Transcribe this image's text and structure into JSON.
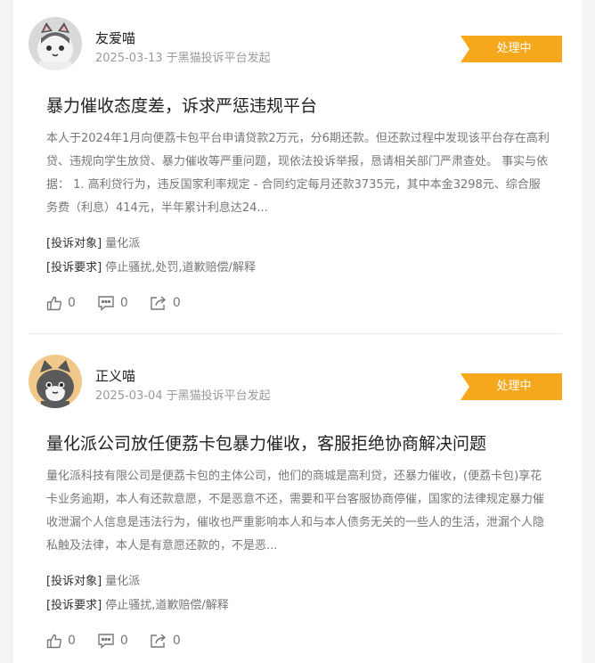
{
  "complaints": [
    {
      "user": "友爱喵",
      "meta": "2025-03-13 于黑猫投诉平台发起",
      "status": "处理中",
      "title": "暴力催收态度差，诉求严惩违规平台",
      "content": "本人于2024年1月向便荔卡包平台申请贷款2万元，分6期还款。但还款过程中发现该平台存在高利贷、违规向学生放贷、暴力催收等严重问题，现依法投诉举报，恳请相关部门严肃查处。 事实与依据： 1. 高利贷行为，违反国家利率规定 - 合同约定每月还款3735元，其中本金3298元、综合服务费（利息）414元，半年累计利息达24...",
      "target_label": "[投诉对象]",
      "target_value": "量化派",
      "demand_label": "[投诉要求]",
      "demand_value": "停止骚扰,处罚,道歉赔偿/解释",
      "likes": "0",
      "comments": "0",
      "shares": "0"
    },
    {
      "user": "正义喵",
      "meta": "2025-03-04 于黑猫投诉平台发起",
      "status": "处理中",
      "title": "量化派公司放任便荔卡包暴力催收，客服拒绝协商解决问题",
      "content": "量化派科技有限公司是便荔卡包的主体公司，他们的商城是高利贷，还暴力催收，(便荔卡包)享花卡业务逾期，本人有还款意愿，不是恶意不还，需要和平台客服协商停催，国家的法律规定暴力催收泄漏个人信息是违法行为，催收也严重影响本人和与本人债务无关的一些人的生活，泄漏个人隐私触及法律，本人是有意愿还款的，不是恶...",
      "target_label": "[投诉对象]",
      "target_value": "量化派",
      "demand_label": "[投诉要求]",
      "demand_value": "停止骚扰,道歉赔偿/解释",
      "likes": "0",
      "comments": "0",
      "shares": "0"
    }
  ],
  "colors": {
    "badge": "#f5a81c",
    "avatar1_bg": "#d9d9d9",
    "avatar2_bg": "#f0c98a"
  },
  "icons": [
    "cat-avatar-icon",
    "thumbs-up-icon",
    "comment-icon",
    "share-icon"
  ]
}
